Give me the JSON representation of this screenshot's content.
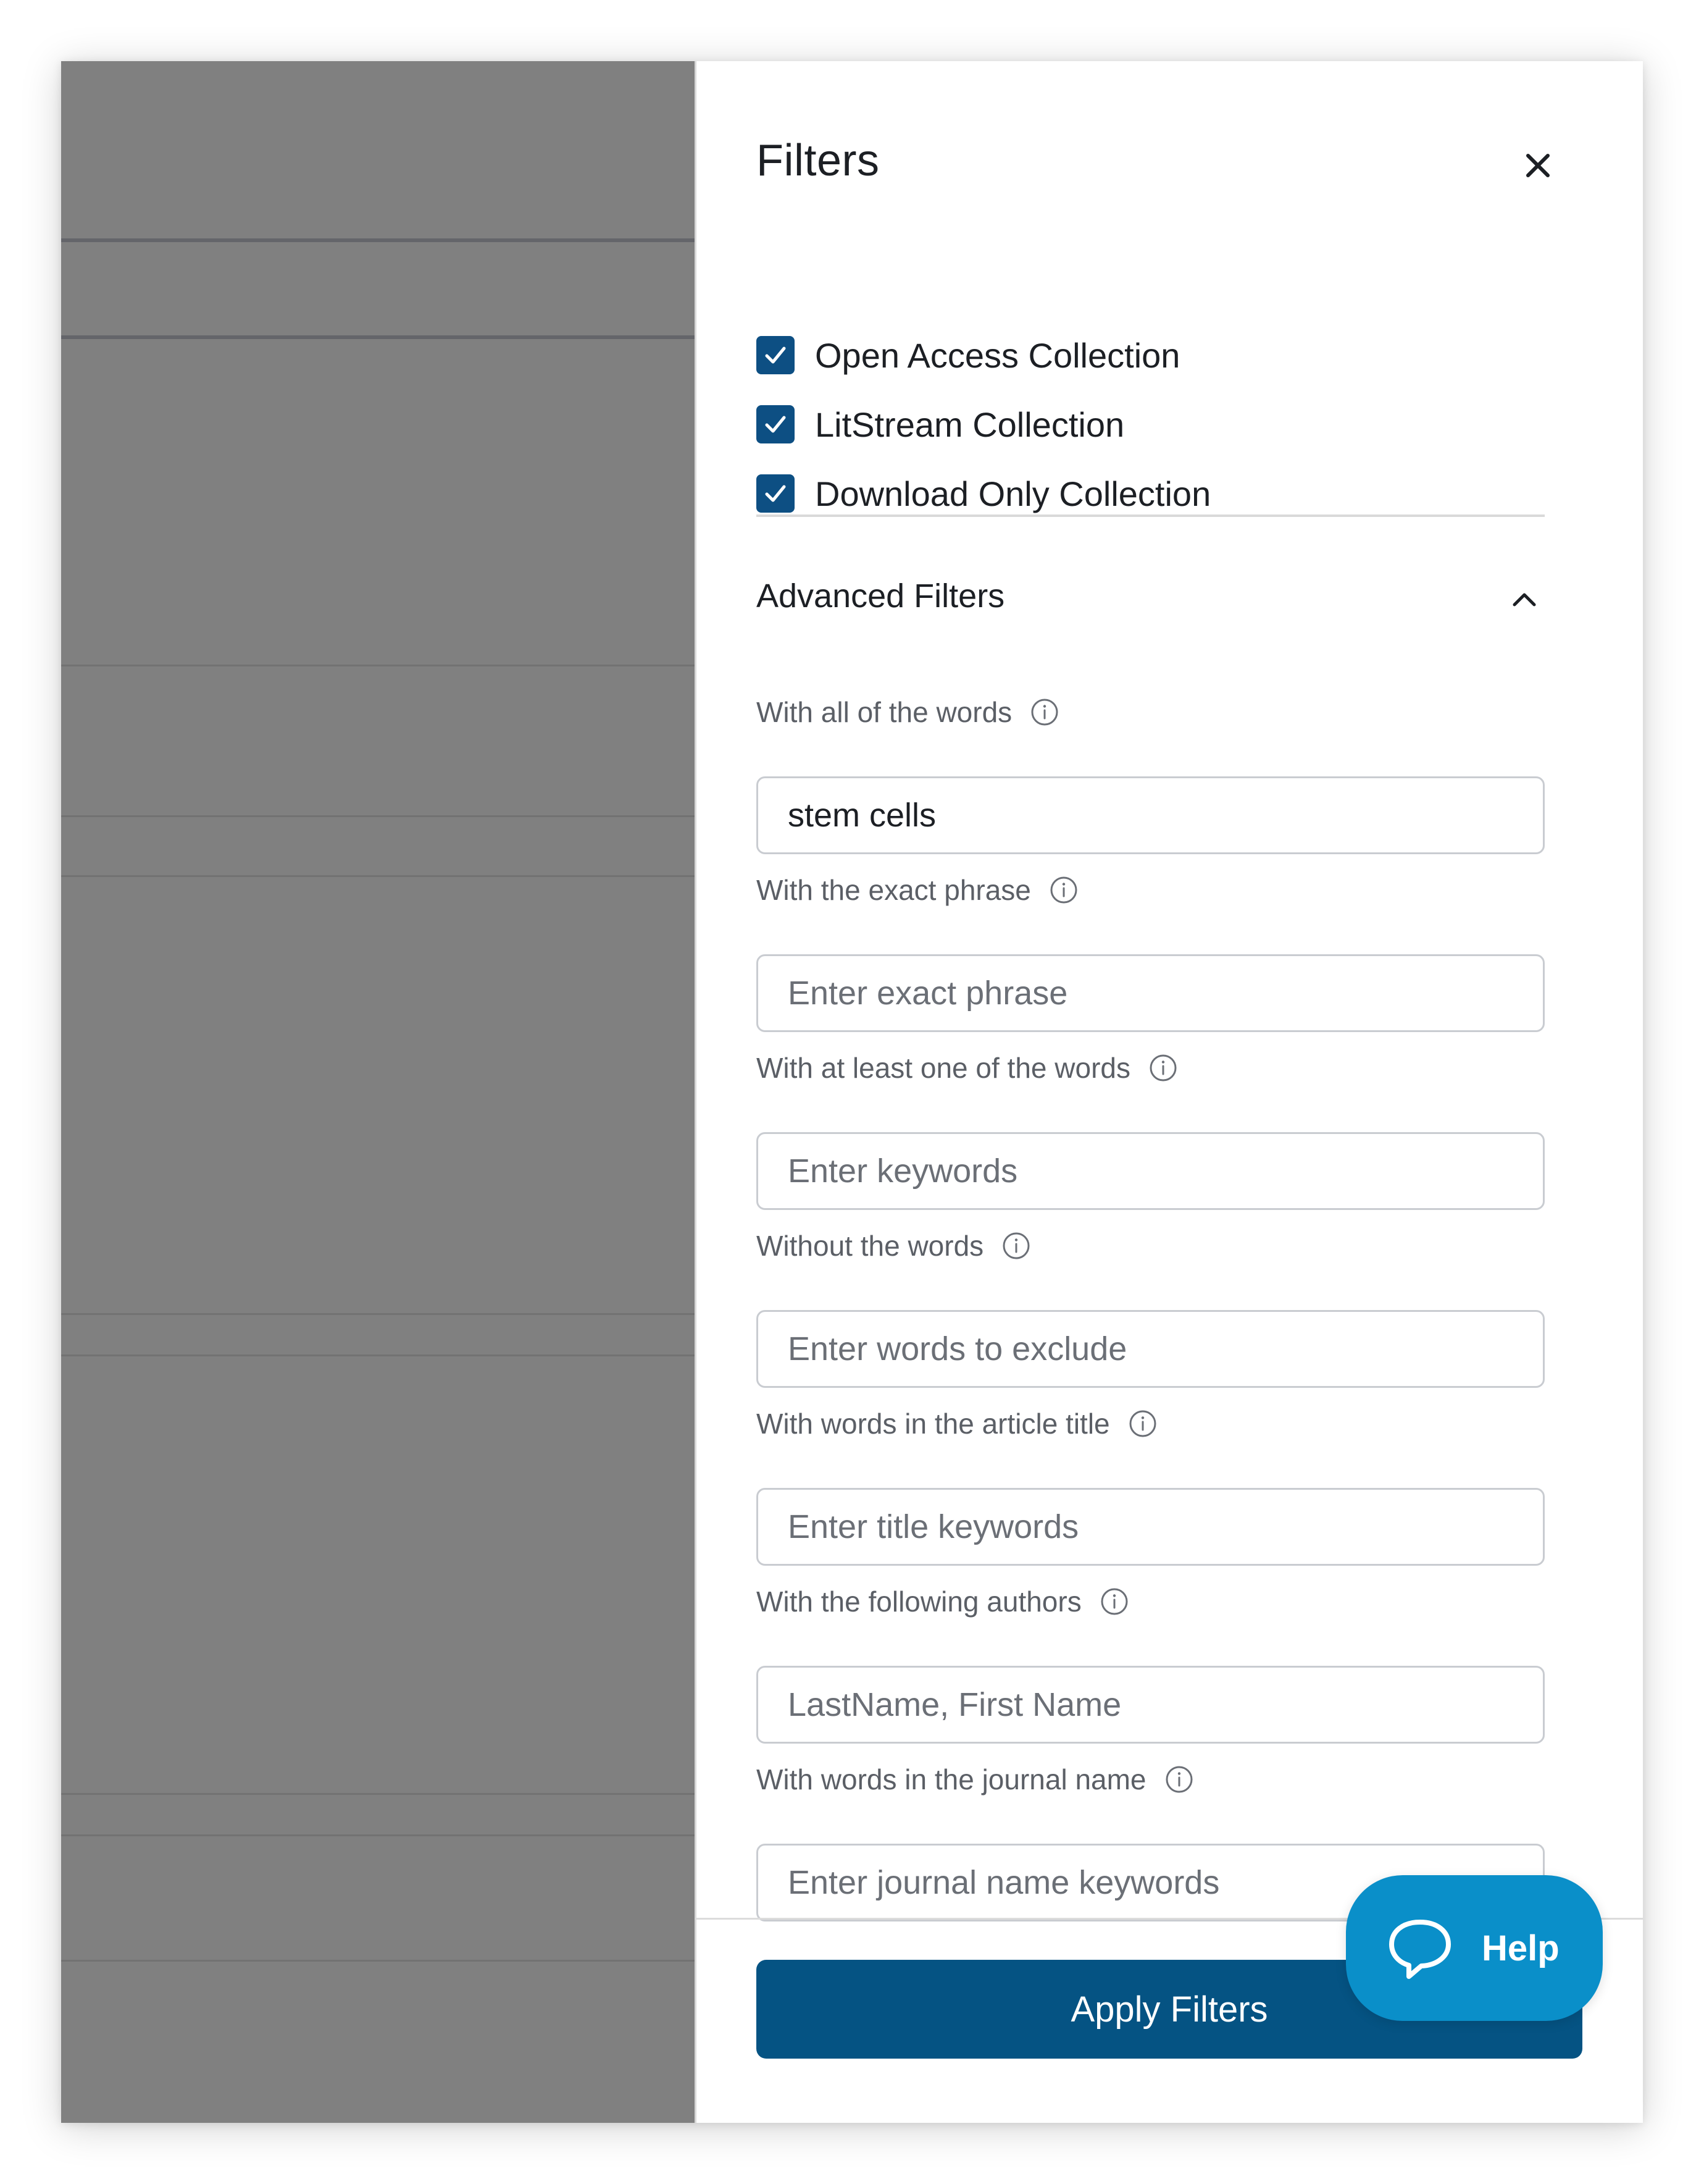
{
  "panel": {
    "title": "Filters",
    "close_icon": "close-icon"
  },
  "collections": [
    {
      "label": "Open Access Collection",
      "checked": true
    },
    {
      "label": "LitStream Collection",
      "checked": true
    },
    {
      "label": "Download Only Collection",
      "checked": true
    }
  ],
  "advanced": {
    "title": "Advanced Filters",
    "expanded": true,
    "fields": [
      {
        "label": "With all of the words",
        "value": "stem cells",
        "placeholder": ""
      },
      {
        "label": "With the exact phrase",
        "value": "",
        "placeholder": "Enter exact phrase"
      },
      {
        "label": "With at least one of the words",
        "value": "",
        "placeholder": "Enter keywords"
      },
      {
        "label": "Without the words",
        "value": "",
        "placeholder": "Enter words to exclude"
      },
      {
        "label": "With words in the article title",
        "value": "",
        "placeholder": "Enter title keywords"
      },
      {
        "label": "With the following authors",
        "value": "",
        "placeholder": "LastName, First Name"
      },
      {
        "label": "With words in the journal name",
        "value": "",
        "placeholder": "Enter journal name keywords"
      }
    ]
  },
  "footer": {
    "apply_label": "Apply Filters"
  },
  "help": {
    "label": "Help",
    "icon": "speech-bubble-icon"
  },
  "colors": {
    "accent": "#055383",
    "checkbox": "#0d4f83",
    "help": "#0a8fc9",
    "overlay": "#808080"
  }
}
